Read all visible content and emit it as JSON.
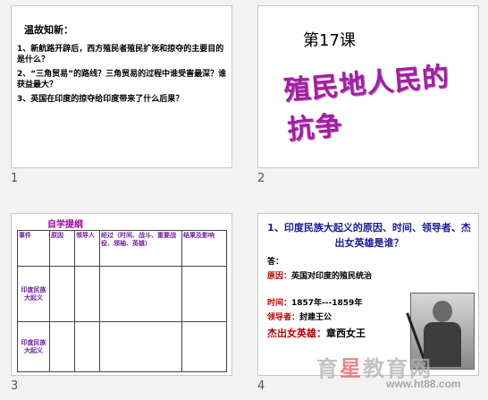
{
  "slides": [
    {
      "number": "1",
      "title": "温故知新：",
      "questions": [
        "1、新航路开辟后，西方殖民者殖民扩张和掠夺的主要目的是什么？",
        "2、“三角贸易”的路线？三角贸易的过程中谁受害最深？谁获益最大？",
        "3、英国在印度的掠夺给印度带来了什么后果？"
      ]
    },
    {
      "number": "2",
      "lesson": "第17课",
      "title": "殖民地人民的抗争"
    },
    {
      "number": "3",
      "title": "自学提纲",
      "headers": [
        "事件",
        "原因",
        "领导人",
        "经过（时间、战斗、重要战役、领袖、英雄）",
        "结果及影响"
      ],
      "rows": [
        "印度民族大起义",
        "印度民族大起义"
      ]
    },
    {
      "number": "4",
      "heading": "1、印度民族大起义的原因、时间、领导者、杰出女英雄是谁？",
      "answer_label": "答：",
      "cause_label": "原因：",
      "cause_value": "英国对印度的殖民统治",
      "time_label": "时间：",
      "time_value": "1857年---1859年",
      "leader_label": "领导者：",
      "leader_value": "封建王公",
      "hero_label": "杰出女英雄：",
      "hero_value": "章西女王"
    }
  ],
  "watermark": {
    "text_a": "育",
    "text_star": "星",
    "text_b": "教育网",
    "url": "www.ht88.com"
  }
}
